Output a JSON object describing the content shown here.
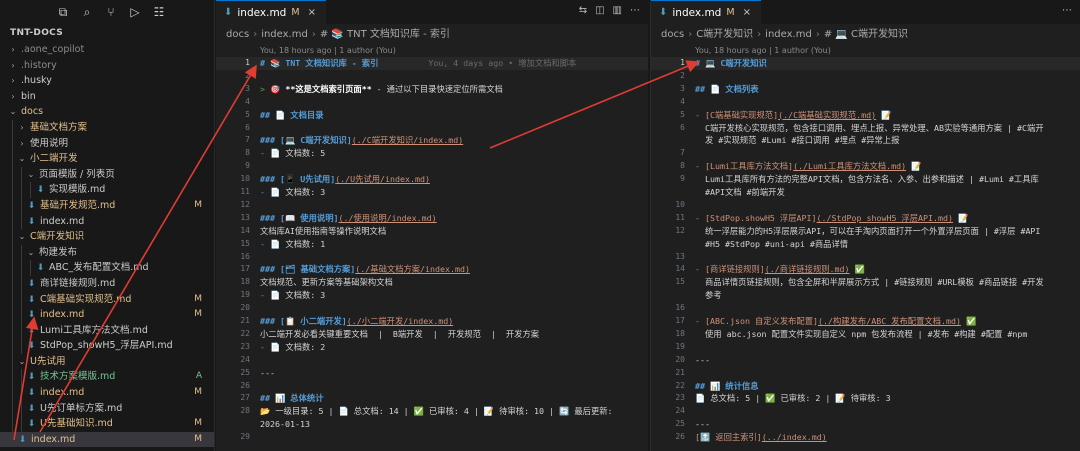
{
  "sidebar": {
    "toolbar_icons": [
      "files-icon",
      "search-icon",
      "source-control-icon",
      "run-debug-icon",
      "extensions-icon"
    ],
    "root_label": "TNT-DOCS",
    "items": [
      {
        "label": ".aone_copilot",
        "type": "folder",
        "depth": 0,
        "open": false,
        "state": "ign",
        "badge": ""
      },
      {
        "label": ".history",
        "type": "folder",
        "depth": 0,
        "open": false,
        "state": "ign",
        "badge": ""
      },
      {
        "label": ".husky",
        "type": "folder",
        "depth": 0,
        "open": false,
        "state": "",
        "badge": ""
      },
      {
        "label": "bin",
        "type": "folder",
        "depth": 0,
        "open": false,
        "state": "",
        "badge": ""
      },
      {
        "label": "docs",
        "type": "folder",
        "depth": 0,
        "open": true,
        "state": "mod",
        "badge": ""
      },
      {
        "label": "基础文档方案",
        "type": "folder",
        "depth": 1,
        "open": false,
        "state": "mod",
        "badge": ""
      },
      {
        "label": "使用说明",
        "type": "folder",
        "depth": 1,
        "open": false,
        "state": "",
        "badge": ""
      },
      {
        "label": "小二端开发",
        "type": "folder",
        "depth": 1,
        "open": true,
        "state": "mod",
        "badge": ""
      },
      {
        "label": "页面模版 / 列表页",
        "type": "folder",
        "depth": 2,
        "open": true,
        "state": "",
        "badge": ""
      },
      {
        "label": "实现模版.md",
        "type": "file",
        "depth": 3,
        "open": false,
        "state": "",
        "badge": ""
      },
      {
        "label": "基础开发规范.md",
        "type": "file",
        "depth": 2,
        "open": false,
        "state": "mod",
        "badge": "M"
      },
      {
        "label": "index.md",
        "type": "file",
        "depth": 2,
        "open": false,
        "state": "",
        "badge": ""
      },
      {
        "label": "C端开发知识",
        "type": "folder",
        "depth": 1,
        "open": true,
        "state": "mod",
        "badge": ""
      },
      {
        "label": "构建发布",
        "type": "folder",
        "depth": 2,
        "open": true,
        "state": "",
        "badge": ""
      },
      {
        "label": "ABC_发布配置文档.md",
        "type": "file",
        "depth": 3,
        "open": false,
        "state": "",
        "badge": ""
      },
      {
        "label": "商详链接规则.md",
        "type": "file",
        "depth": 2,
        "open": false,
        "state": "",
        "badge": ""
      },
      {
        "label": "C端基础实现规范.md",
        "type": "file",
        "depth": 2,
        "open": false,
        "state": "mod",
        "badge": "M"
      },
      {
        "label": "index.md",
        "type": "file",
        "depth": 2,
        "open": false,
        "state": "mod",
        "badge": "M"
      },
      {
        "label": "Lumi工具库方法文档.md",
        "type": "file",
        "depth": 2,
        "open": false,
        "state": "",
        "badge": ""
      },
      {
        "label": "StdPop_showH5_浮层API.md",
        "type": "file",
        "depth": 2,
        "open": false,
        "state": "",
        "badge": ""
      },
      {
        "label": "U先试用",
        "type": "folder",
        "depth": 1,
        "open": true,
        "state": "mod",
        "badge": ""
      },
      {
        "label": "技术方案模版.md",
        "type": "file",
        "depth": 2,
        "open": false,
        "state": "add",
        "badge": "A"
      },
      {
        "label": "index.md",
        "type": "file",
        "depth": 2,
        "open": false,
        "state": "mod",
        "badge": "M"
      },
      {
        "label": "U先订单标方案.md",
        "type": "file",
        "depth": 2,
        "open": false,
        "state": "",
        "badge": ""
      },
      {
        "label": "U先基础知识.md",
        "type": "file",
        "depth": 2,
        "open": false,
        "state": "mod",
        "badge": "M"
      },
      {
        "label": "index.md",
        "type": "file",
        "depth": 1,
        "open": false,
        "state": "mod",
        "badge": "M",
        "selected": true
      }
    ]
  },
  "left_editor": {
    "tab": {
      "name": "index.md",
      "mod": "M",
      "close": "×"
    },
    "actions": [
      "split-icon",
      "preview-icon",
      "more-icon"
    ],
    "breadcrumb": [
      "docs",
      "index.md",
      "# 📚 TNT 文档知识库 - 索引"
    ],
    "blame_top": "You, 18 hours ago | 1 author (You)",
    "lines": [
      {
        "n": 1,
        "parts": [
          {
            "c": "k-head",
            "t": "# 📚 TNT 文档知识库 - 索引"
          },
          {
            "c": "k-ghost",
            "t": "          You, 4 days ago • 增加文档和脚本"
          }
        ],
        "cur": true
      },
      {
        "n": 2,
        "parts": []
      },
      {
        "n": 3,
        "parts": [
          {
            "c": "k-quote",
            "t": "> 🎯 "
          },
          {
            "c": "k-bold",
            "t": "**这是文档索引页面**"
          },
          {
            "c": "k-text",
            "t": " - 通过以下目录快速定位所需文档"
          }
        ]
      },
      {
        "n": 4,
        "parts": []
      },
      {
        "n": 5,
        "parts": [
          {
            "c": "k-head",
            "t": "## 📄 文档目录"
          }
        ]
      },
      {
        "n": 6,
        "parts": []
      },
      {
        "n": 7,
        "parts": [
          {
            "c": "k-head",
            "t": "### [💻 C端开发知识]"
          },
          {
            "c": "k-url",
            "t": "(./C端开发知识/index.md)"
          }
        ]
      },
      {
        "n": 8,
        "parts": [
          {
            "c": "k-list",
            "t": "- "
          },
          {
            "c": "k-text",
            "t": "📄 文档数: 5"
          }
        ]
      },
      {
        "n": 9,
        "parts": []
      },
      {
        "n": 10,
        "parts": [
          {
            "c": "k-head",
            "t": "### [📱 U先试用]"
          },
          {
            "c": "k-url",
            "t": "(./U先试用/index.md)"
          }
        ]
      },
      {
        "n": 11,
        "parts": [
          {
            "c": "k-list",
            "t": "- "
          },
          {
            "c": "k-text",
            "t": "📄 文档数: 3"
          }
        ]
      },
      {
        "n": 12,
        "parts": []
      },
      {
        "n": 13,
        "parts": [
          {
            "c": "k-head",
            "t": "### [📖 使用说明]"
          },
          {
            "c": "k-url",
            "t": "(./使用说明/index.md)"
          }
        ]
      },
      {
        "n": 14,
        "parts": [
          {
            "c": "k-text",
            "t": "文档库AI使用指南等操作说明文档"
          }
        ]
      },
      {
        "n": 15,
        "parts": [
          {
            "c": "k-list",
            "t": "- "
          },
          {
            "c": "k-text",
            "t": "📄 文档数: 1"
          }
        ]
      },
      {
        "n": 16,
        "parts": []
      },
      {
        "n": 17,
        "parts": [
          {
            "c": "k-head",
            "t": "### [🗂 基础文档方案]"
          },
          {
            "c": "k-url",
            "t": "(./基础文档方案/index.md)"
          }
        ]
      },
      {
        "n": 18,
        "parts": [
          {
            "c": "k-text",
            "t": "文档规范、更新方案等基础架构文档"
          }
        ]
      },
      {
        "n": 19,
        "parts": [
          {
            "c": "k-list",
            "t": "- "
          },
          {
            "c": "k-text",
            "t": "📄 文档数: 3"
          }
        ]
      },
      {
        "n": 20,
        "parts": []
      },
      {
        "n": 21,
        "parts": [
          {
            "c": "k-head",
            "t": "### [📋 小二端开发]"
          },
          {
            "c": "k-url",
            "t": "(./小二端开发/index.md)"
          }
        ]
      },
      {
        "n": 22,
        "parts": [
          {
            "c": "k-text",
            "t": "小二端开发必看关键重要文档  |  B端开发  |  开发规范  |  开发方案"
          }
        ]
      },
      {
        "n": 23,
        "parts": [
          {
            "c": "k-list",
            "t": "- "
          },
          {
            "c": "k-text",
            "t": "📄 文档数: 2"
          }
        ]
      },
      {
        "n": 24,
        "parts": []
      },
      {
        "n": 25,
        "parts": [
          {
            "c": "k-hr",
            "t": "---"
          }
        ]
      },
      {
        "n": 26,
        "parts": []
      },
      {
        "n": 27,
        "parts": [
          {
            "c": "k-head",
            "t": "## 📊 总体统计"
          }
        ]
      },
      {
        "n": 28,
        "parts": [
          {
            "c": "k-text",
            "t": "📂 一级目录: 5 | 📄 总文档: 14 | ✅ 已审核: 4 | 📝 待审核: 10 | 🔄 最后更新:"
          }
        ]
      },
      {
        "n": "",
        "parts": [
          {
            "c": "k-text",
            "t": "2026-01-13"
          }
        ]
      },
      {
        "n": 29,
        "parts": []
      }
    ]
  },
  "right_editor": {
    "tab": {
      "name": "index.md",
      "mod": "M",
      "close": "×"
    },
    "actions": [
      "more-icon"
    ],
    "breadcrumb": [
      "docs",
      "C端开发知识",
      "index.md",
      "# 💻 C端开发知识"
    ],
    "blame_top": "You, 18 hours ago | 1 author (You)",
    "lines": [
      {
        "n": 1,
        "parts": [
          {
            "c": "k-head",
            "t": "# 💻 C端开发知识"
          }
        ],
        "cur": true
      },
      {
        "n": 2,
        "parts": []
      },
      {
        "n": 3,
        "parts": [
          {
            "c": "k-head",
            "t": "## 📄 文档列表"
          }
        ]
      },
      {
        "n": 4,
        "parts": []
      },
      {
        "n": 5,
        "parts": [
          {
            "c": "k-list",
            "t": "- "
          },
          {
            "c": "k-link",
            "t": "[C端基础实现规范]"
          },
          {
            "c": "k-url",
            "t": "(./C端基础实现规范.md)"
          },
          {
            "c": "k-text",
            "t": " 📝"
          }
        ]
      },
      {
        "n": 6,
        "parts": [
          {
            "c": "k-text",
            "t": "  C端开发核心实现规范，包含接口调用、埋点上报、异常处理、AB实验等通用方案 | #C端开"
          }
        ]
      },
      {
        "n": "",
        "parts": [
          {
            "c": "k-text",
            "t": "  发 #实现规范 #Lumi #接口调用 #埋点 #异常上报"
          }
        ]
      },
      {
        "n": 7,
        "parts": []
      },
      {
        "n": 8,
        "parts": [
          {
            "c": "k-list",
            "t": "- "
          },
          {
            "c": "k-link",
            "t": "[Lumi工具库方法文档]"
          },
          {
            "c": "k-url",
            "t": "(./Lumi工具库方法文档.md)"
          },
          {
            "c": "k-text",
            "t": " 📝"
          }
        ]
      },
      {
        "n": 9,
        "parts": [
          {
            "c": "k-text",
            "t": "  Lumi工具库所有方法的完整API文档，包含方法名、入参、出参和描述 | #Lumi #工具库"
          }
        ]
      },
      {
        "n": "",
        "parts": [
          {
            "c": "k-text",
            "t": "  #API文档 #前端开发"
          }
        ]
      },
      {
        "n": 10,
        "parts": []
      },
      {
        "n": 11,
        "parts": [
          {
            "c": "k-list",
            "t": "- "
          },
          {
            "c": "k-link",
            "t": "[StdPop.showH5 浮层API]"
          },
          {
            "c": "k-url",
            "t": "(./StdPop_showH5_浮层API.md)"
          },
          {
            "c": "k-text",
            "t": " 📝"
          }
        ]
      },
      {
        "n": 12,
        "parts": [
          {
            "c": "k-text",
            "t": "  统一浮层能力的H5浮层展示API，可以在手淘内页面打开一个外置浮层页面 | #浮层 #API"
          }
        ]
      },
      {
        "n": "",
        "parts": [
          {
            "c": "k-text",
            "t": "  #H5 #StdPop #uni-api #商品详情"
          }
        ]
      },
      {
        "n": 13,
        "parts": []
      },
      {
        "n": 14,
        "parts": [
          {
            "c": "k-list",
            "t": "- "
          },
          {
            "c": "k-link",
            "t": "[商详链接规则]"
          },
          {
            "c": "k-url",
            "t": "(./商详链接规则.md)"
          },
          {
            "c": "k-text",
            "t": " ✅"
          }
        ]
      },
      {
        "n": 15,
        "parts": [
          {
            "c": "k-text",
            "t": "  商品详情页链接规则，包含全屏和半屏展示方式 | #链接规则 #URL模板 #商品链接 #开发"
          }
        ]
      },
      {
        "n": "",
        "parts": [
          {
            "c": "k-text",
            "t": "  参考"
          }
        ]
      },
      {
        "n": 16,
        "parts": []
      },
      {
        "n": 17,
        "parts": [
          {
            "c": "k-list",
            "t": "- "
          },
          {
            "c": "k-link",
            "t": "[ABC.json 自定义发布配置]"
          },
          {
            "c": "k-url",
            "t": "(./构建发布/ABC_发布配置文档.md)"
          },
          {
            "c": "k-text",
            "t": " ✅"
          }
        ]
      },
      {
        "n": 18,
        "parts": [
          {
            "c": "k-text",
            "t": "  使用 abc.json 配置文件实现自定义 npm 包发布流程 | #发布 #构建 #配置 #npm"
          }
        ]
      },
      {
        "n": 19,
        "parts": []
      },
      {
        "n": 20,
        "parts": [
          {
            "c": "k-hr",
            "t": "---"
          }
        ]
      },
      {
        "n": 21,
        "parts": []
      },
      {
        "n": 22,
        "parts": [
          {
            "c": "k-head",
            "t": "## 📊 统计信息"
          }
        ]
      },
      {
        "n": 23,
        "parts": [
          {
            "c": "k-text",
            "t": "📄 总文档: 5 | ✅ 已审核: 2 | 📝 待审核: 3"
          }
        ]
      },
      {
        "n": 24,
        "parts": []
      },
      {
        "n": 25,
        "parts": [
          {
            "c": "k-hr",
            "t": "---"
          }
        ]
      },
      {
        "n": 26,
        "parts": [
          {
            "c": "k-link",
            "t": "[🔝 返回主索引]"
          },
          {
            "c": "k-url",
            "t": "(../index.md)"
          }
        ]
      }
    ]
  },
  "annotation_color": "#e03c31"
}
